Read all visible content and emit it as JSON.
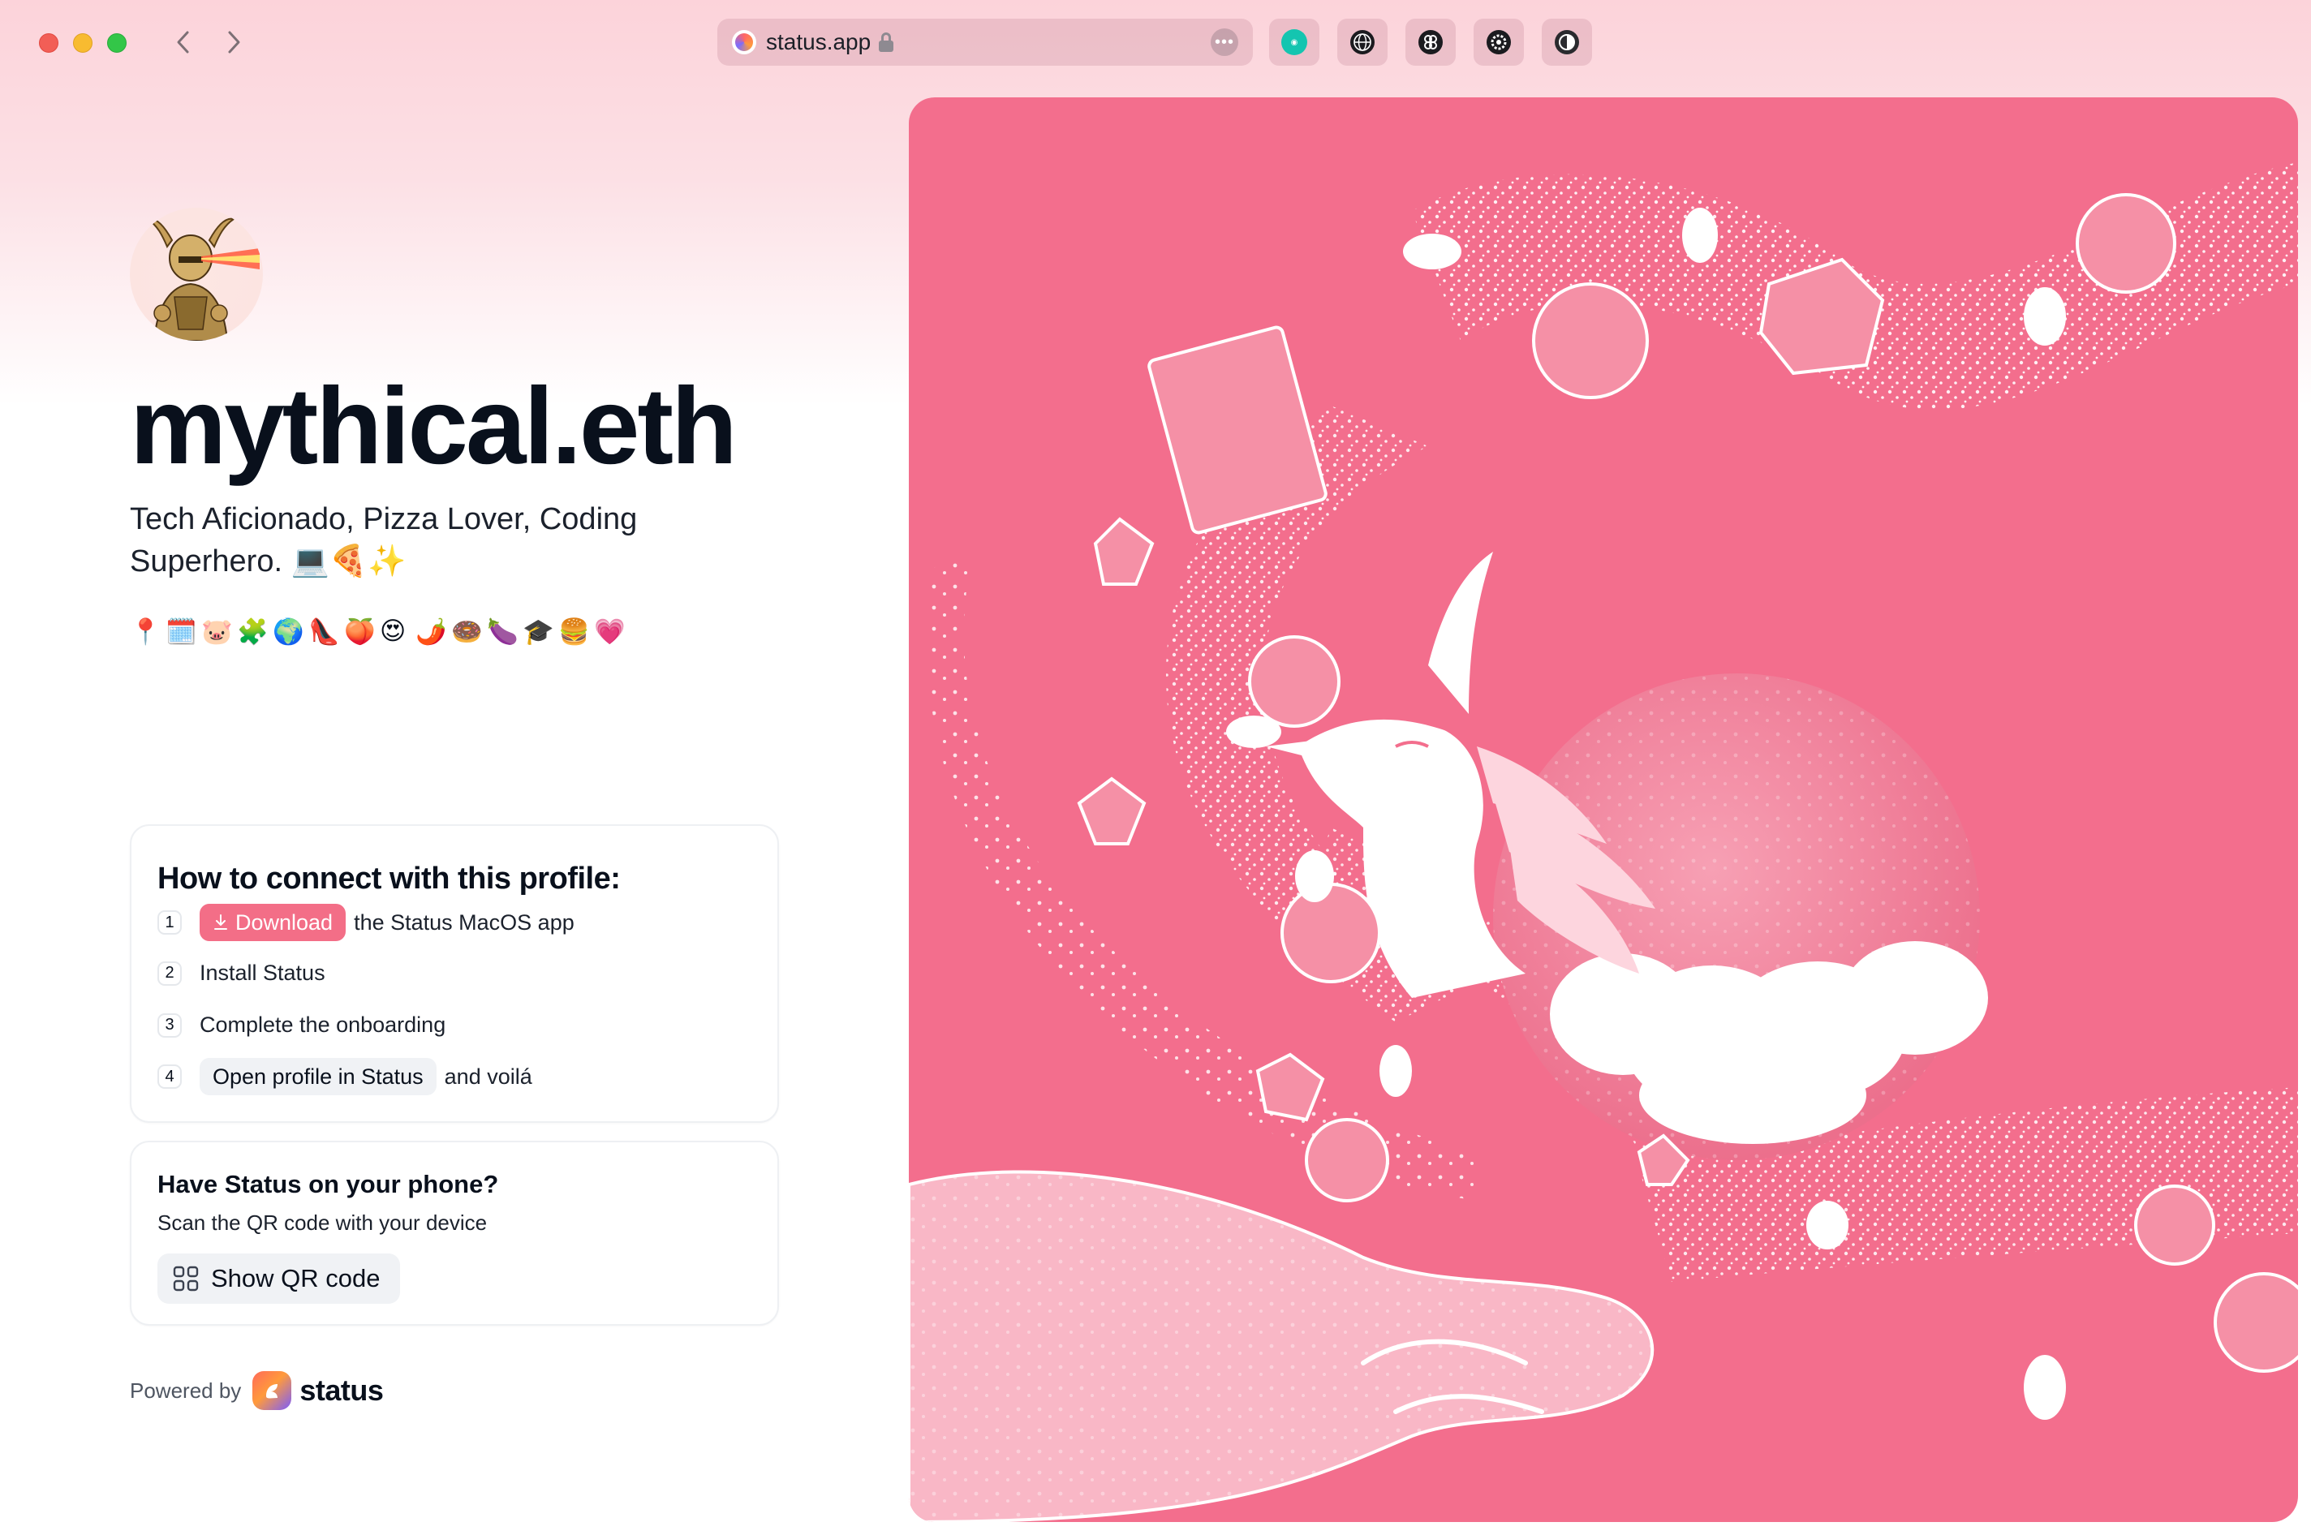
{
  "browser": {
    "url": "status.app",
    "extensions": [
      "teal-extension-icon",
      "web-icon",
      "link-icon",
      "gear-icon",
      "contrast-icon"
    ]
  },
  "profile": {
    "name": "mythical.eth",
    "bio": "Tech Aficionado, Pizza Lover, Coding Superhero. 💻🍕✨",
    "emojis": [
      "📍",
      "🗓️",
      "🐷",
      "🧩",
      "🌍",
      "👠",
      "🍑",
      "😍",
      "🌶️",
      "🍩",
      "🍆",
      "🎓",
      "🍔",
      "💗"
    ]
  },
  "connect": {
    "title": "How to connect with this profile:",
    "steps": [
      {
        "num": "1",
        "button": "Download",
        "text": "the Status MacOS app"
      },
      {
        "num": "2",
        "text": "Install Status"
      },
      {
        "num": "3",
        "text": "Complete the onboarding"
      },
      {
        "num": "4",
        "button": "Open profile in Status",
        "text": "and voilá"
      }
    ]
  },
  "phone": {
    "title": "Have Status on your phone?",
    "subtitle": "Scan the QR code with your device",
    "button": "Show QR code"
  },
  "footer": {
    "powered_by": "Powered by",
    "brand": "status"
  },
  "colors": {
    "accent": "#f36e87",
    "hero_background": "#f36e8d",
    "text": "#09101c"
  }
}
